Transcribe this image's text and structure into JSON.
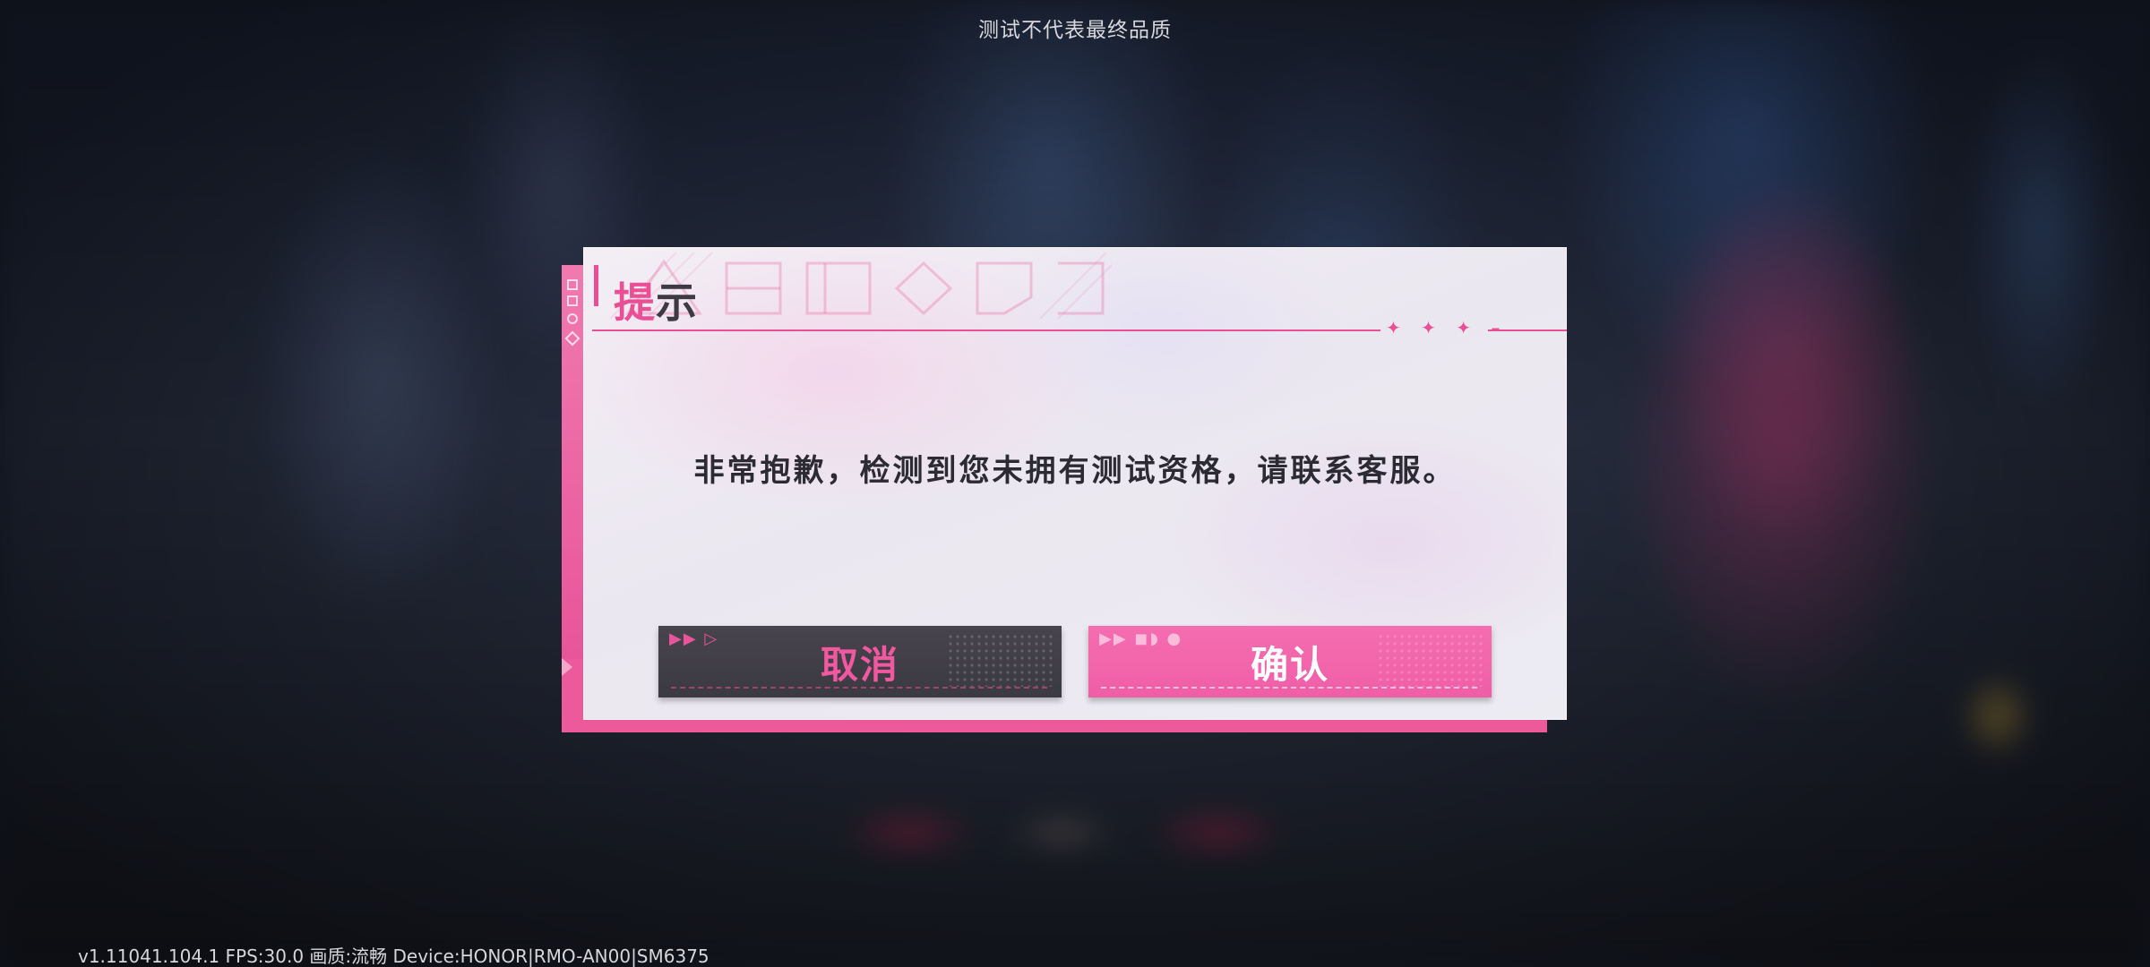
{
  "top_notice": "测试不代表最终品质",
  "debug_info": "v1.11041.104.1 FPS:30.0 画质:流畅 Device:HONOR|RMO-AN00|SM6375",
  "dialog": {
    "title_accent": "提",
    "title_rest": "示",
    "title_ornament": "✦ ✦  ✦ –",
    "message": "非常抱歉，检测到您未拥有测试资格，请联系客服。",
    "cancel_label": "取消",
    "confirm_label": "确认"
  },
  "icons": {
    "cancel_arrows": "play-arrows-icon",
    "confirm_arrows": "play-arrows-icon"
  },
  "colors": {
    "accent": "#ea4f95",
    "cancel_bg": "#403e46",
    "confirm_bg": "#f265ab",
    "text_dark": "#2c2a33"
  }
}
